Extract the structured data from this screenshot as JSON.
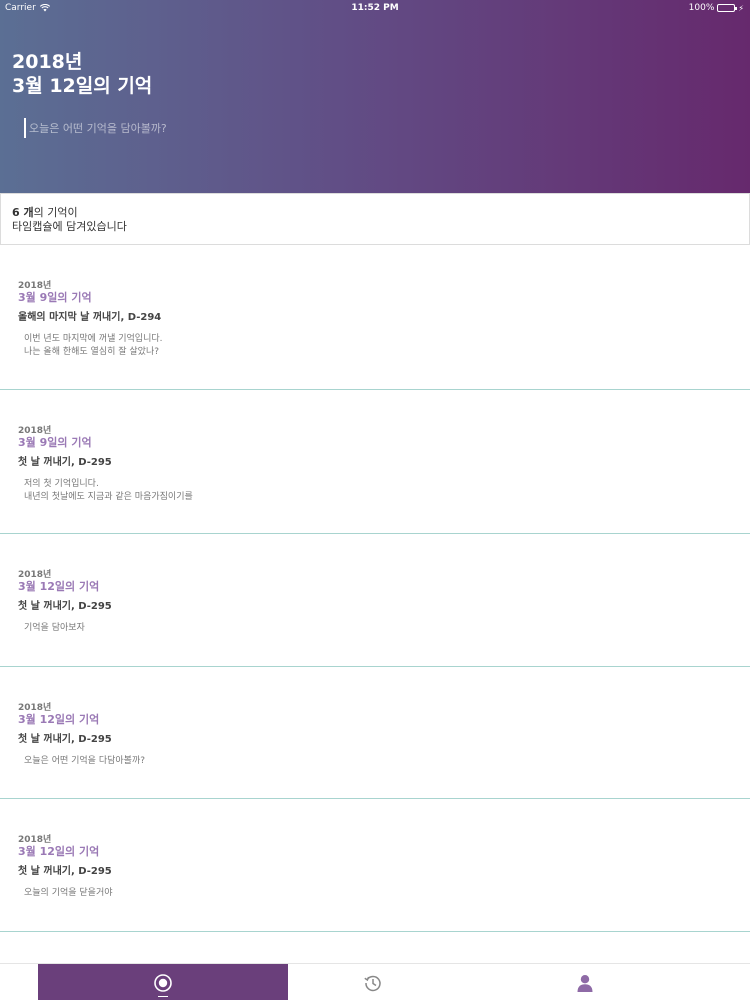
{
  "status_bar": {
    "carrier": "Carrier",
    "time": "11:52 PM",
    "battery": "100%"
  },
  "header": {
    "year": "2018년",
    "date": "3월 12일의 기억",
    "input_placeholder": "오늘은 어떤 기억을 담아볼까?"
  },
  "summary": {
    "count": "6 개",
    "line1_suffix": "의 기억이",
    "line2": "타임캡슐에 담겨있습니다"
  },
  "memories": [
    {
      "year": "2018년",
      "date": "3월 9일의 기억",
      "title": "올해의 마지막 날 꺼내기, D-294",
      "body": "이번 년도 마지막에 꺼낼 기억입니다.\n나는 올해 한해도 열심히 잘 살았나?"
    },
    {
      "year": "2018년",
      "date": "3월 9일의 기억",
      "title": "첫 날 꺼내기, D-295",
      "body": "저의 첫 기억입니다.\n내년의 첫날에도 지금과 같은 마음가짐이기를"
    },
    {
      "year": "2018년",
      "date": "3월 12일의 기억",
      "title": "첫 날 꺼내기, D-295",
      "body": "기억을 담아보자"
    },
    {
      "year": "2018년",
      "date": "3월 12일의 기억",
      "title": "첫 날 꺼내기, D-295",
      "body": "오늘은 어떤 기억을 다담아볼까?"
    },
    {
      "year": "2018년",
      "date": "3월 12일의 기억",
      "title": "첫 날 꺼내기, D-295",
      "body": "오늘의 기억을 닫을거야"
    }
  ],
  "tabs": [
    {
      "icon": "capsule-icon",
      "active": true
    },
    {
      "icon": "history-icon",
      "active": false
    },
    {
      "icon": "profile-icon",
      "active": false
    }
  ],
  "colors": {
    "header_gradient_start": "#5b6f94",
    "header_gradient_end": "#66296d",
    "accent": "#9a79b5",
    "tab_active": "#6a3f7b",
    "divider": "#a8d4cf"
  }
}
